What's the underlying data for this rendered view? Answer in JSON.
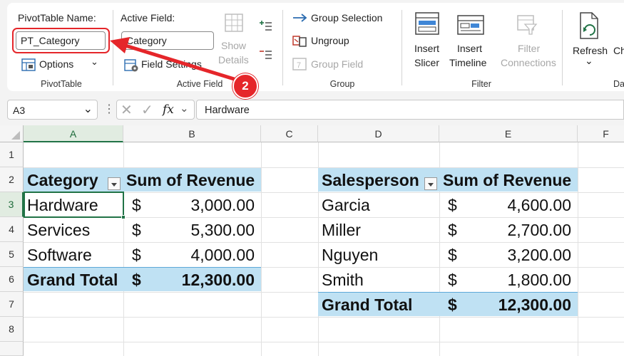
{
  "ribbon": {
    "pivottable_group": {
      "name_label": "PivotTable Name:",
      "name_value": "PT_Category",
      "options_label": "Options",
      "group_label": "PivotTable"
    },
    "active_field_group": {
      "field_label": "Active Field:",
      "field_value": "Category",
      "field_settings_label": "Field Settings",
      "show_details_line1": "Show",
      "show_details_line2": "Details",
      "group_label": "Active Field"
    },
    "group_group": {
      "group_selection": "Group Selection",
      "ungroup": "Ungroup",
      "group_field": "Group Field",
      "group_label": "Group"
    },
    "filter_group": {
      "insert_slicer_line1": "Insert",
      "insert_slicer_line2": "Slicer",
      "insert_timeline_line1": "Insert",
      "insert_timeline_line2": "Timeline",
      "filter_connections_line1": "Filter",
      "filter_connections_line2": "Connections",
      "group_label": "Filter"
    },
    "data_group": {
      "refresh_label": "Refresh",
      "refresh_chevron": "⌄",
      "change_partial": "Ch",
      "data_partial": "Da"
    }
  },
  "callout": {
    "step_number": "2",
    "color": "#e5262a"
  },
  "formula_bar": {
    "name_box": "A3",
    "fx": "fx",
    "formula": "Hardware"
  },
  "sheet": {
    "columns": [
      "A",
      "B",
      "C",
      "D",
      "E",
      "F"
    ],
    "rows": [
      "1",
      "2",
      "3",
      "4",
      "5",
      "6",
      "7",
      "8"
    ],
    "pivot1": {
      "header": [
        "Category",
        "Sum of Revenue"
      ],
      "rows": [
        {
          "label": "Hardware",
          "currency": "$",
          "value": "3,000.00"
        },
        {
          "label": "Services",
          "currency": "$",
          "value": "5,300.00"
        },
        {
          "label": "Software",
          "currency": "$",
          "value": "4,000.00"
        }
      ],
      "total": {
        "label": "Grand Total",
        "currency": "$",
        "value": "12,300.00"
      }
    },
    "pivot2": {
      "header": [
        "Salesperson",
        "Sum of Revenue"
      ],
      "rows": [
        {
          "label": "Garcia",
          "currency": "$",
          "value": "4,600.00"
        },
        {
          "label": "Miller",
          "currency": "$",
          "value": "2,700.00"
        },
        {
          "label": "Nguyen",
          "currency": "$",
          "value": "3,200.00"
        },
        {
          "label": "Smith",
          "currency": "$",
          "value": "1,800.00"
        }
      ],
      "total": {
        "label": "Grand Total",
        "currency": "$",
        "value": "12,300.00"
      }
    },
    "header_band_color": "#bfe1f3",
    "selection_color": "#217346"
  }
}
